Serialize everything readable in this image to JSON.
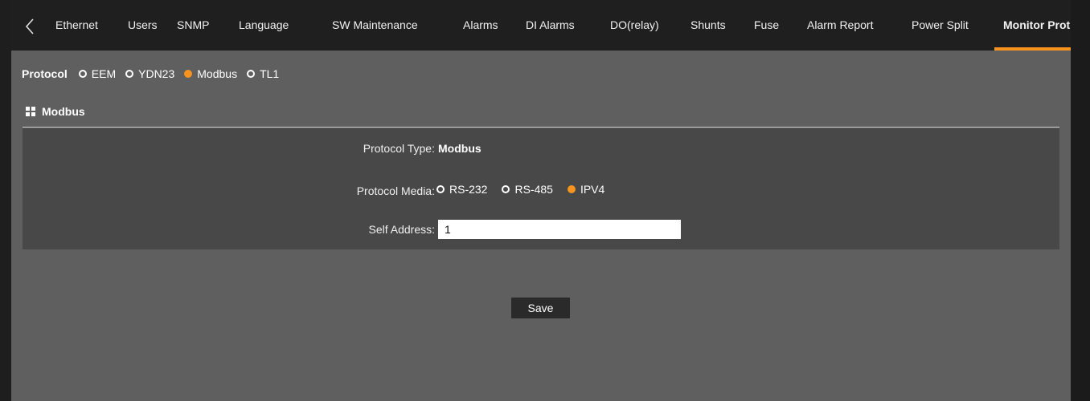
{
  "tabs": [
    {
      "label": "Ethernet"
    },
    {
      "label": "Users"
    },
    {
      "label": "SNMP"
    },
    {
      "label": "Language"
    },
    {
      "label": "SW Maintenance"
    },
    {
      "label": "Alarms"
    },
    {
      "label": "DI Alarms"
    },
    {
      "label": "DO(relay)"
    },
    {
      "label": "Shunts"
    },
    {
      "label": "Fuse"
    },
    {
      "label": "Alarm Report"
    },
    {
      "label": "Power Split"
    },
    {
      "label": "Monitor Prot"
    }
  ],
  "active_tab_index": 12,
  "colors": {
    "accent": "#f7931e",
    "background": "#5f5f5f",
    "panel": "#484848",
    "tabbar": "#1f1f1f"
  },
  "protocol": {
    "label": "Protocol",
    "options": [
      {
        "label": "EEM",
        "selected": false
      },
      {
        "label": "YDN23",
        "selected": false
      },
      {
        "label": "Modbus",
        "selected": true
      },
      {
        "label": "TL1",
        "selected": false
      }
    ]
  },
  "section": {
    "title": "Modbus",
    "icon": "grid-icon"
  },
  "form": {
    "protocol_type": {
      "label": "Protocol Type:",
      "value": "Modbus"
    },
    "protocol_media": {
      "label": "Protocol Media:",
      "options": [
        {
          "label": "RS-232",
          "selected": false
        },
        {
          "label": "RS-485",
          "selected": false
        },
        {
          "label": "IPV4",
          "selected": true
        }
      ]
    },
    "self_address": {
      "label": "Self Address:",
      "value": "1"
    }
  },
  "save_label": "Save"
}
